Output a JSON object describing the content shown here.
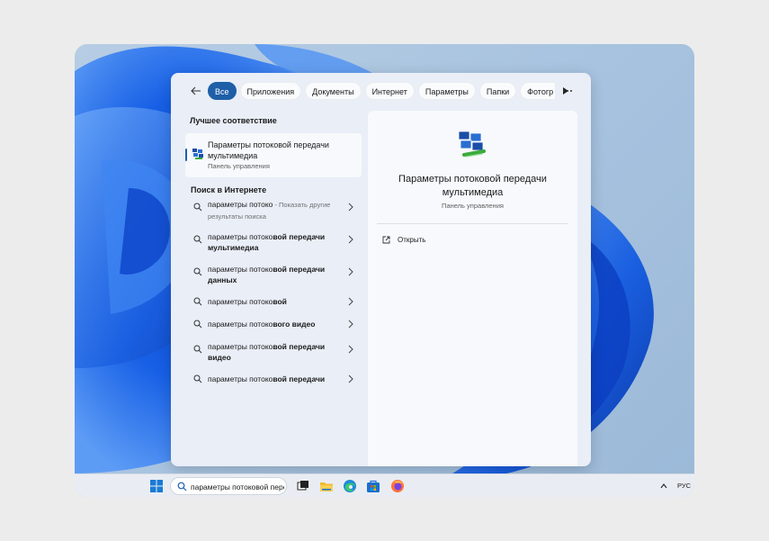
{
  "filters": {
    "items": [
      "Все",
      "Приложения",
      "Документы",
      "Интернет",
      "Параметры",
      "Папки",
      "Фотогр"
    ],
    "active_index": 0
  },
  "best_match": {
    "section_title": "Лучшее соответствие",
    "title": "Параметры потоковой передачи мультимедиа",
    "subtitle": "Панель управления"
  },
  "web": {
    "section_title": "Поиск в Интернете",
    "results": [
      {
        "prefix": "параметры потоко",
        "bold": "",
        "hint": " - Показать другие результаты поиска"
      },
      {
        "prefix": "параметры потоко",
        "bold": "вой передачи мультимедиа",
        "hint": ""
      },
      {
        "prefix": "параметры потоко",
        "bold": "вой передачи данных",
        "hint": ""
      },
      {
        "prefix": "параметры потоко",
        "bold": "вой",
        "hint": ""
      },
      {
        "prefix": "параметры потоко",
        "bold": "вого видео",
        "hint": ""
      },
      {
        "prefix": "параметры потоко",
        "bold": "вой передачи видео",
        "hint": ""
      },
      {
        "prefix": "параметры потоко",
        "bold": "вой передачи",
        "hint": ""
      }
    ]
  },
  "detail": {
    "title": "Параметры потоковой передачи мультимедиа",
    "subtitle": "Панель управления",
    "open_label": "Открыть"
  },
  "taskbar": {
    "search_value": "параметры потоковой передачи мультимедиа",
    "language": "РУС",
    "apps": [
      "start-icon",
      "task-view-icon",
      "file-explorer-icon",
      "edge-icon",
      "store-icon",
      "firefox-icon"
    ]
  },
  "colors": {
    "accent": "#1f5fa8",
    "wallpaper_blue": "#1a5fe0"
  }
}
